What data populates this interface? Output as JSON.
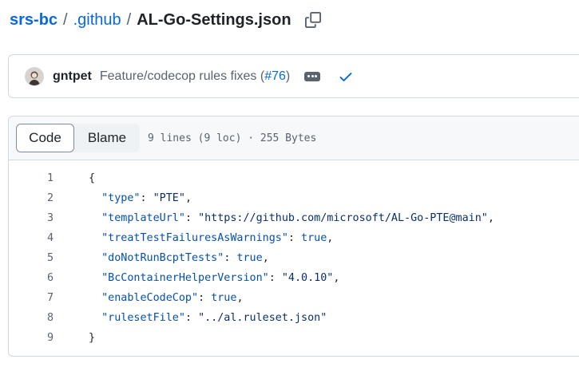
{
  "breadcrumb": {
    "repo": "srs-bc",
    "folder": ".github",
    "file": "AL-Go-Settings.json",
    "separator": "/"
  },
  "commit": {
    "author": "gntpet",
    "message_prefix": "Feature/codecop rules fixes (",
    "pr_link": "#76",
    "message_suffix": ")",
    "status": "success"
  },
  "file_header": {
    "tabs": [
      "Code",
      "Blame"
    ],
    "active_tab": "Code",
    "info": "9 lines (9 loc) · 255 Bytes"
  },
  "code_lines": [
    {
      "n": "1",
      "indent": "",
      "parts": [
        {
          "t": "p",
          "v": "{"
        }
      ]
    },
    {
      "n": "2",
      "indent": "  ",
      "parts": [
        {
          "t": "k",
          "v": "\"type\""
        },
        {
          "t": "p",
          "v": ": "
        },
        {
          "t": "s",
          "v": "\"PTE\""
        },
        {
          "t": "p",
          "v": ","
        }
      ]
    },
    {
      "n": "3",
      "indent": "  ",
      "parts": [
        {
          "t": "k",
          "v": "\"templateUrl\""
        },
        {
          "t": "p",
          "v": ": "
        },
        {
          "t": "s",
          "v": "\"https://github.com/microsoft/AL-Go-PTE@main\""
        },
        {
          "t": "p",
          "v": ","
        }
      ]
    },
    {
      "n": "4",
      "indent": "  ",
      "parts": [
        {
          "t": "k",
          "v": "\"treatTestFailuresAsWarnings\""
        },
        {
          "t": "p",
          "v": ": "
        },
        {
          "t": "l",
          "v": "true"
        },
        {
          "t": "p",
          "v": ","
        }
      ]
    },
    {
      "n": "5",
      "indent": "  ",
      "parts": [
        {
          "t": "k",
          "v": "\"doNotRunBcptTests\""
        },
        {
          "t": "p",
          "v": ": "
        },
        {
          "t": "l",
          "v": "true"
        },
        {
          "t": "p",
          "v": ","
        }
      ]
    },
    {
      "n": "6",
      "indent": "  ",
      "parts": [
        {
          "t": "k",
          "v": "\"BcContainerHelperVersion\""
        },
        {
          "t": "p",
          "v": ": "
        },
        {
          "t": "s",
          "v": "\"4.0.10\""
        },
        {
          "t": "p",
          "v": ","
        }
      ]
    },
    {
      "n": "7",
      "indent": "  ",
      "parts": [
        {
          "t": "k",
          "v": "\"enableCodeCop\""
        },
        {
          "t": "p",
          "v": ": "
        },
        {
          "t": "l",
          "v": "true"
        },
        {
          "t": "p",
          "v": ","
        }
      ]
    },
    {
      "n": "8",
      "indent": "  ",
      "parts": [
        {
          "t": "k",
          "v": "\"rulesetFile\""
        },
        {
          "t": "p",
          "v": ": "
        },
        {
          "t": "s",
          "v": "\"../al.ruleset.json\""
        }
      ]
    },
    {
      "n": "9",
      "indent": "",
      "parts": [
        {
          "t": "p",
          "v": "}"
        }
      ]
    }
  ],
  "icons": {
    "copy": "copy-icon",
    "ellipsis": "ellipsis-icon",
    "check": "check-icon",
    "avatar": "avatar"
  },
  "colors": {
    "link": "#0969da",
    "success": "#0969da",
    "json_key": "#0550ae",
    "json_string": "#0a3069"
  }
}
